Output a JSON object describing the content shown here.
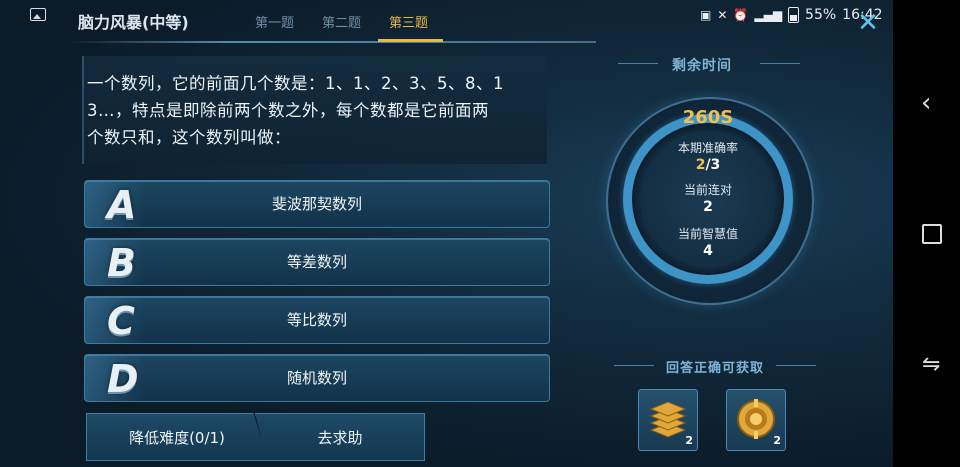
{
  "status_bar": {
    "battery": "55%",
    "time": "16:42"
  },
  "header": {
    "title": "脑力风暴(中等)",
    "tabs": [
      {
        "label": "第一题",
        "active": false
      },
      {
        "label": "第二题",
        "active": false
      },
      {
        "label": "第三题",
        "active": true
      }
    ]
  },
  "question": {
    "lines": [
      "一个数列，它的前面几个数是：1、1、2、3、5、8、1",
      "3…，特点是即除前两个数之外，每个数都是它前面两",
      "个数只和，这个数列叫做："
    ]
  },
  "options": [
    {
      "letter": "A",
      "text": "斐波那契数列"
    },
    {
      "letter": "B",
      "text": "等差数列"
    },
    {
      "letter": "C",
      "text": "等比数列"
    },
    {
      "letter": "D",
      "text": "随机数列"
    }
  ],
  "buttons": {
    "lower_difficulty": "降低难度(0/1)",
    "ask_help": "去求助"
  },
  "timer": {
    "title": "剩余时间",
    "remaining": "260S",
    "accuracy_label": "本期准确率",
    "accuracy_correct": "2",
    "accuracy_total": "/3",
    "streak_label": "当前连对",
    "streak_value": "2",
    "wisdom_label": "当前智慧值",
    "wisdom_value": "4"
  },
  "rewards": {
    "title": "回答正确可获取",
    "items": [
      {
        "icon": "book-stack-icon",
        "count": "2"
      },
      {
        "icon": "gold-badge-icon",
        "count": "2"
      }
    ]
  },
  "colors": {
    "accent_gold": "#f2c14a",
    "accent_blue": "#3e93c7"
  }
}
